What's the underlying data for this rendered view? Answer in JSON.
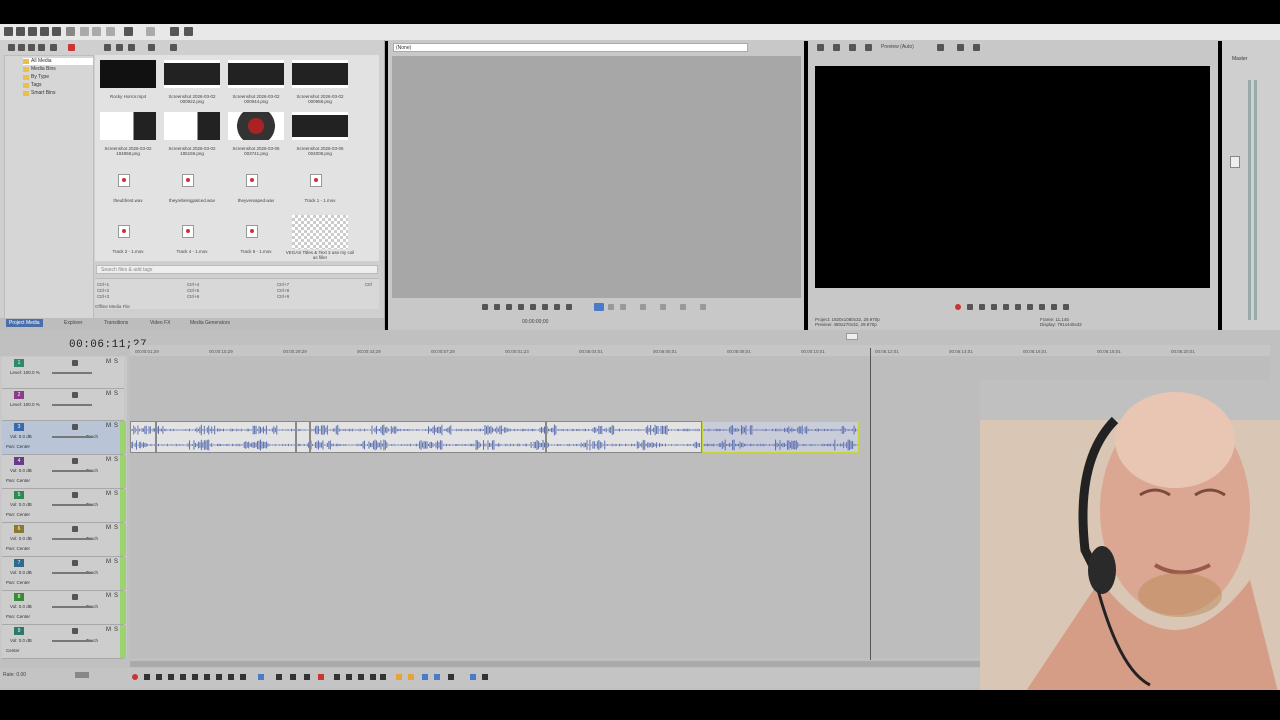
{
  "explorer": {
    "tree": [
      "All Media",
      "Media Bins",
      "By Type",
      "Tags",
      "Smart Bins"
    ],
    "media": [
      {
        "label": "Rocky Horror.mp4",
        "kind": "video-dark"
      },
      {
        "label": "Screenshot 2026-03-02 000922.png",
        "kind": "image"
      },
      {
        "label": "Screenshot 2026-03-02 000944.png",
        "kind": "image"
      },
      {
        "label": "Screenshot 2026-03-02 000958.png",
        "kind": "image"
      },
      {
        "label": "Screenshot 2026-03-02 184858.png",
        "kind": "image-light"
      },
      {
        "label": "Screenshot 2026-03-02 185159.png",
        "kind": "image-light"
      },
      {
        "label": "Screenshot 2026-03-05 003741.png",
        "kind": "image-color"
      },
      {
        "label": "Screenshot 2026-03-05 004008.png",
        "kind": "image"
      },
      {
        "label": "theubfrest.wav",
        "kind": "audio"
      },
      {
        "label": "theyrebeingpalced.wav",
        "kind": "audio"
      },
      {
        "label": "theyvereaped.wav",
        "kind": "audio"
      },
      {
        "label": "Track 1 - 1.mov",
        "kind": "audio"
      },
      {
        "label": "Track 2 - 1.mov",
        "kind": "audio"
      },
      {
        "label": "Track 4 - 1.mov",
        "kind": "audio"
      },
      {
        "label": "Track 6 - 1.mov",
        "kind": "audio"
      },
      {
        "label": "VEGAS Titles & Text 3 use my coil as filler",
        "kind": "checker"
      }
    ],
    "search_placeholder": "Search files & add tags",
    "shortcuts": [
      "Ctrl+1",
      "Ctrl+2",
      "Ctrl+3",
      "Ctrl+4",
      "Ctrl+5",
      "Ctrl+6",
      "Ctrl+7",
      "Ctrl+8",
      "Ctrl+9",
      "Ctrl"
    ],
    "footer": "Offline Media File",
    "tabs": [
      "Project Media",
      "Explorer",
      "Transitions",
      "Video FX",
      "Media Generators"
    ]
  },
  "trimmer": {
    "dropdown": "(None)",
    "time": "00:00:00;00"
  },
  "preview": {
    "mode": "Preview (Auto)",
    "project": "Project: 1920x1080x32, 29.970p",
    "preview_res": "Preview: 480x270x32, 29.970p",
    "frame": "Frame: 11,145",
    "display": "Display: 791x445x32"
  },
  "master": {
    "label": "Master"
  },
  "timeline": {
    "timecode": "00:06:11;27",
    "ruler": [
      "00:00:01;29",
      "00:00:15;29",
      "00:00:29;29",
      "00:00:43;29",
      "00:00:57;29",
      "00:00:01;23",
      "00:06:04;01",
      "00:06:06;01",
      "00:06:08;01",
      "00:00:10;01",
      "00:06:12;01",
      "00:06:14;01",
      "00:06:16;01",
      "00:06:18;01",
      "00:06:20;01"
    ],
    "tracks": [
      {
        "num": "1",
        "color": "#2e8a6e",
        "line1": "Level: 100.0 %",
        "line2": ""
      },
      {
        "num": "2",
        "color": "#8a3e8a",
        "line1": "Level: 100.0 %",
        "line2": ""
      },
      {
        "num": "3",
        "color": "#3a6aa8",
        "line1": "Vol: 0.0 dB",
        "line2": "Pan: Center"
      },
      {
        "num": "4",
        "color": "#6a3a8a",
        "line1": "Vol: 0.0 dB",
        "line2": "Pan: Center"
      },
      {
        "num": "5",
        "color": "#2e8a4e",
        "line1": "Vol: 0.0 dB",
        "line2": "Pan: Center"
      },
      {
        "num": "6",
        "color": "#8a7a2e",
        "line1": "Vol: 0.0 dB",
        "line2": "Pan: Center"
      },
      {
        "num": "7",
        "color": "#2e6a8a",
        "line1": "Vol: 0.0 dB",
        "line2": "Pan: Center"
      },
      {
        "num": "8",
        "color": "#3a8a3a",
        "line1": "Vol: 0.0 dB",
        "line2": "Pan: Center"
      },
      {
        "num": "9",
        "color": "#2e7a6a",
        "line1": "Vol: 0.0 dB",
        "line2": "Center"
      }
    ],
    "touch": "Touch",
    "rate": "Rate: 0.00"
  },
  "colors": {
    "wave": "#5a6fb0",
    "selected_border": "#c4d43a"
  }
}
